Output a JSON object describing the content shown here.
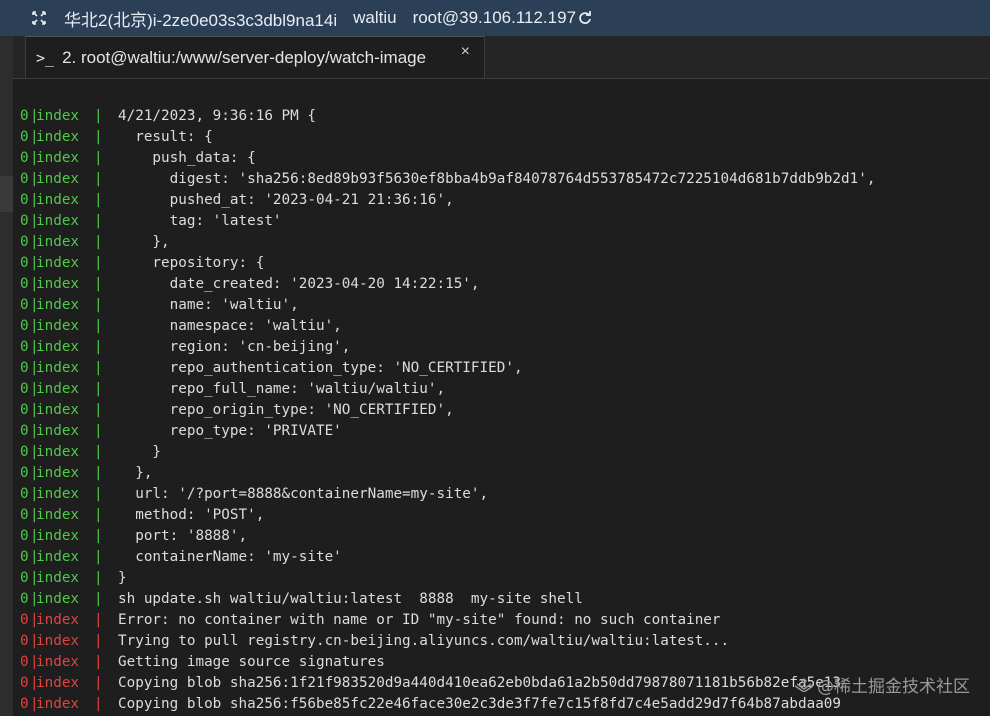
{
  "titlebar": {
    "region": "华北2(北京)",
    "instance_id": "i-2ze0e03s3c3dbl9na14i",
    "user": "waltiu",
    "host": "root@39.106.112.197"
  },
  "tab": {
    "title": "2. root@waltiu:/www/server-deploy/watch-image",
    "prompt_glyph": ">_",
    "close_glyph": "×"
  },
  "colors": {
    "ok": "#4ec94a",
    "error": "#e0443e",
    "text": "#dcdcdc",
    "titlebar_bg": "#2b3f57"
  },
  "terminal": {
    "lines": [
      {
        "id": "0",
        "name": "index",
        "status": "ok",
        "text": "4/21/2023, 9:36:16 PM {"
      },
      {
        "id": "0",
        "name": "index",
        "status": "ok",
        "text": "  result: {"
      },
      {
        "id": "0",
        "name": "index",
        "status": "ok",
        "text": "    push_data: {"
      },
      {
        "id": "0",
        "name": "index",
        "status": "ok",
        "text": "      digest: 'sha256:8ed89b93f5630ef8bba4b9af84078764d553785472c7225104d681b7ddb9b2d1',"
      },
      {
        "id": "0",
        "name": "index",
        "status": "ok",
        "text": "      pushed_at: '2023-04-21 21:36:16',"
      },
      {
        "id": "0",
        "name": "index",
        "status": "ok",
        "text": "      tag: 'latest'"
      },
      {
        "id": "0",
        "name": "index",
        "status": "ok",
        "text": "    },"
      },
      {
        "id": "0",
        "name": "index",
        "status": "ok",
        "text": "    repository: {"
      },
      {
        "id": "0",
        "name": "index",
        "status": "ok",
        "text": "      date_created: '2023-04-20 14:22:15',"
      },
      {
        "id": "0",
        "name": "index",
        "status": "ok",
        "text": "      name: 'waltiu',"
      },
      {
        "id": "0",
        "name": "index",
        "status": "ok",
        "text": "      namespace: 'waltiu',"
      },
      {
        "id": "0",
        "name": "index",
        "status": "ok",
        "text": "      region: 'cn-beijing',"
      },
      {
        "id": "0",
        "name": "index",
        "status": "ok",
        "text": "      repo_authentication_type: 'NO_CERTIFIED',"
      },
      {
        "id": "0",
        "name": "index",
        "status": "ok",
        "text": "      repo_full_name: 'waltiu/waltiu',"
      },
      {
        "id": "0",
        "name": "index",
        "status": "ok",
        "text": "      repo_origin_type: 'NO_CERTIFIED',"
      },
      {
        "id": "0",
        "name": "index",
        "status": "ok",
        "text": "      repo_type: 'PRIVATE'"
      },
      {
        "id": "0",
        "name": "index",
        "status": "ok",
        "text": "    }"
      },
      {
        "id": "0",
        "name": "index",
        "status": "ok",
        "text": "  },"
      },
      {
        "id": "0",
        "name": "index",
        "status": "ok",
        "text": "  url: '/?port=8888&containerName=my-site',"
      },
      {
        "id": "0",
        "name": "index",
        "status": "ok",
        "text": "  method: 'POST',"
      },
      {
        "id": "0",
        "name": "index",
        "status": "ok",
        "text": "  port: '8888',"
      },
      {
        "id": "0",
        "name": "index",
        "status": "ok",
        "text": "  containerName: 'my-site'"
      },
      {
        "id": "0",
        "name": "index",
        "status": "ok",
        "text": "}"
      },
      {
        "id": "0",
        "name": "index",
        "status": "ok",
        "text": "sh update.sh waltiu/waltiu:latest  8888  my-site shell"
      },
      {
        "id": "0",
        "name": "index",
        "status": "err",
        "text": "Error: no container with name or ID \"my-site\" found: no such container"
      },
      {
        "id": "0",
        "name": "index",
        "status": "err",
        "text": "Trying to pull registry.cn-beijing.aliyuncs.com/waltiu/waltiu:latest..."
      },
      {
        "id": "0",
        "name": "index",
        "status": "err",
        "text": "Getting image source signatures"
      },
      {
        "id": "0",
        "name": "index",
        "status": "err",
        "text": "Copying blob sha256:1f21f983520d9a440d410ea62eb0bda61a2b50dd79878071181b56b82efa5e13"
      },
      {
        "id": "0",
        "name": "index",
        "status": "err",
        "text": "Copying blob sha256:f56be85fc22e46face30e2c3de3f7fe7c15f8fd7c4e5add29d7f64b87abdaa09"
      }
    ]
  },
  "watermark": {
    "text": "@稀土掘金技术社区"
  }
}
